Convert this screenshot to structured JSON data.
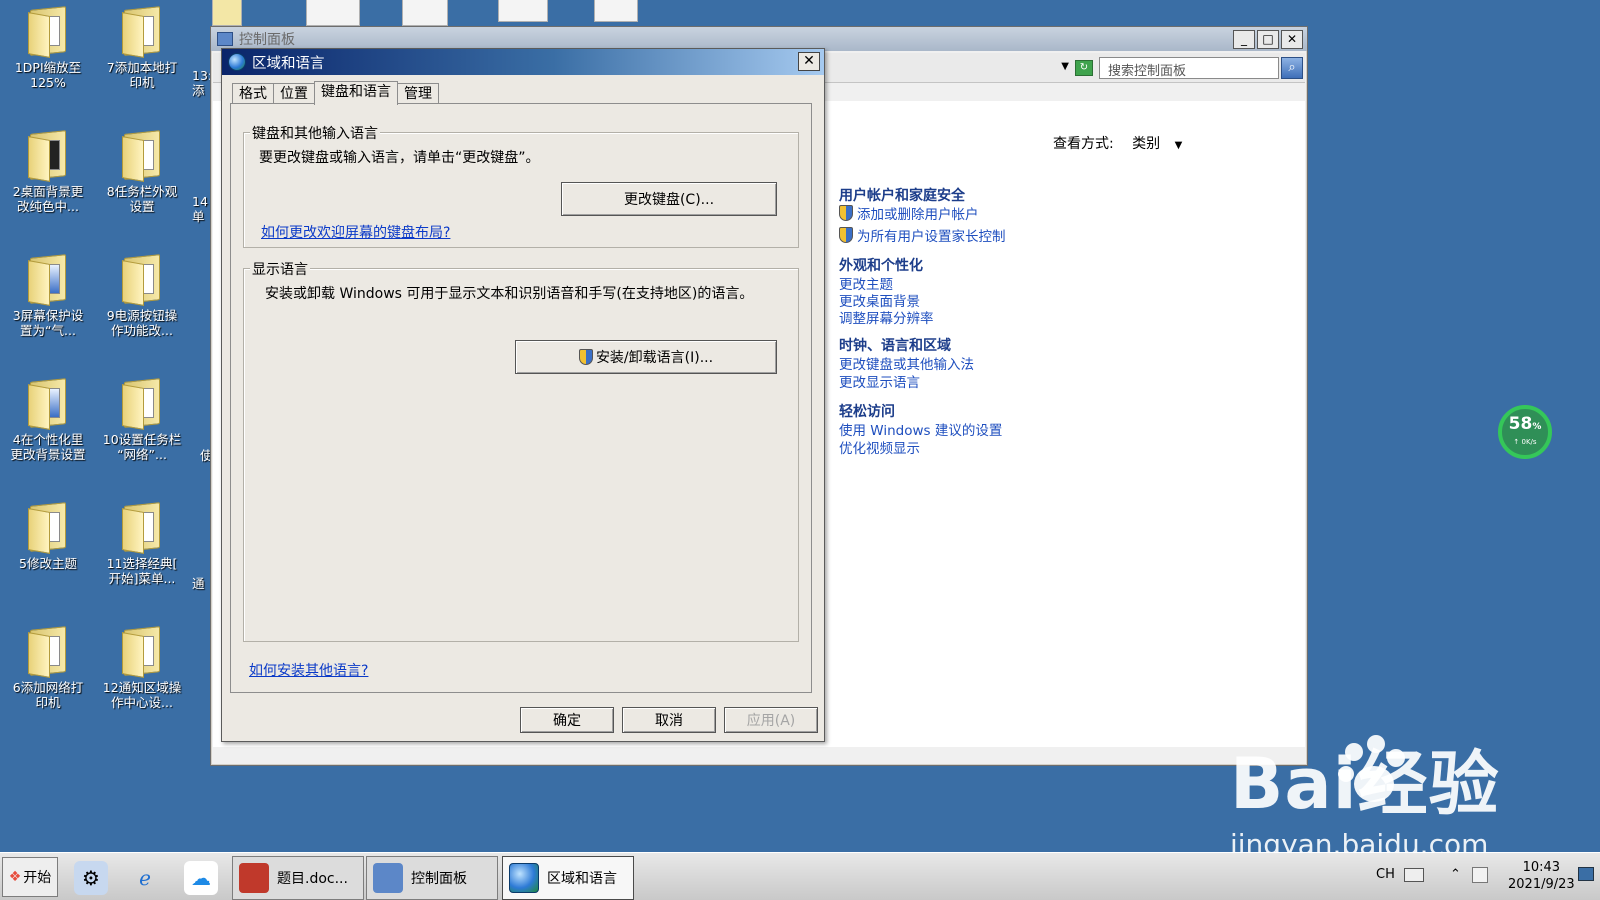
{
  "desktop": {
    "icons": [
      {
        "label": "1DPI缩放至\n125%",
        "doc": "white"
      },
      {
        "label": "7添加本地打\n印机",
        "doc": "white"
      },
      {
        "label": "2桌面背景更\n改纯色中...",
        "doc": "dark"
      },
      {
        "label": "8任务栏外观\n设置",
        "doc": "white"
      },
      {
        "label": "3屏幕保护设\n置为“气...",
        "doc": "blue"
      },
      {
        "label": "9电源按钮操\n作功能改...",
        "doc": "white"
      },
      {
        "label": "4在个性化里\n更改背景设置",
        "doc": "blue"
      },
      {
        "label": "10设置任务栏\n“网络”...",
        "doc": "white"
      },
      {
        "label": "5修改主题",
        "doc": "white"
      },
      {
        "label": "11选择经典[\n开始]菜单...",
        "doc": "white"
      },
      {
        "label": "6添加网络打\n印机",
        "doc": "white"
      },
      {
        "label": "12通知区域操\n作中心设...",
        "doc": "white"
      }
    ],
    "partial_labels": [
      "13:\n添",
      "14\n单",
      "使",
      "通"
    ]
  },
  "control_panel": {
    "title": "控制面板",
    "search_placeholder": "搜索控制面板",
    "view_by_label": "查看方式:",
    "view_by_value": "类别",
    "categories": [
      {
        "title": "用户帐户和家庭安全",
        "links": [
          "添加或删除用户帐户",
          "为所有用户设置家长控制"
        ]
      },
      {
        "title": "外观和个性化",
        "links": [
          "更改主题",
          "更改桌面背景",
          "调整屏幕分辨率"
        ]
      },
      {
        "title": "时钟、语言和区域",
        "links": [
          "更改键盘或其他输入法",
          "更改显示语言"
        ]
      },
      {
        "title": "轻松访问",
        "links": [
          "使用 Windows 建议的设置",
          "优化视频显示"
        ]
      }
    ]
  },
  "region_dialog": {
    "title": "区域和语言",
    "tabs": [
      "格式",
      "位置",
      "键盘和语言",
      "管理"
    ],
    "active_tab": "键盘和语言",
    "keyboard_group": {
      "label": "键盘和其他输入语言",
      "description": "要更改键盘或输入语言，请单击“更改键盘”。",
      "button": "更改键盘(C)...",
      "link": "如何更改欢迎屏幕的键盘布局?"
    },
    "display_group": {
      "label": "显示语言",
      "description": "安装或卸载 Windows 可用于显示文本和识别语音和手写(在支持地区)的语言。",
      "button": "安装/卸载语言(I)..."
    },
    "bottom_link": "如何安装其他语言?",
    "ok": "确定",
    "cancel": "取消",
    "apply": "应用(A)"
  },
  "gauge": {
    "percent": "58",
    "unit": "%",
    "speed": "↑ 0K/s"
  },
  "watermark": {
    "brand": "Bai经验",
    "url": "jingyan.baidu.com"
  },
  "taskbar": {
    "start": "开始",
    "tasks": [
      "题目.doc...",
      "控制面板",
      "区域和语言"
    ],
    "tray_lang": "CH",
    "time": "10:43",
    "date": "2021/9/23"
  },
  "colors": {
    "desktop": "#3a6ea5",
    "link": "#1f4fbf",
    "category": "#1c3d8a"
  }
}
